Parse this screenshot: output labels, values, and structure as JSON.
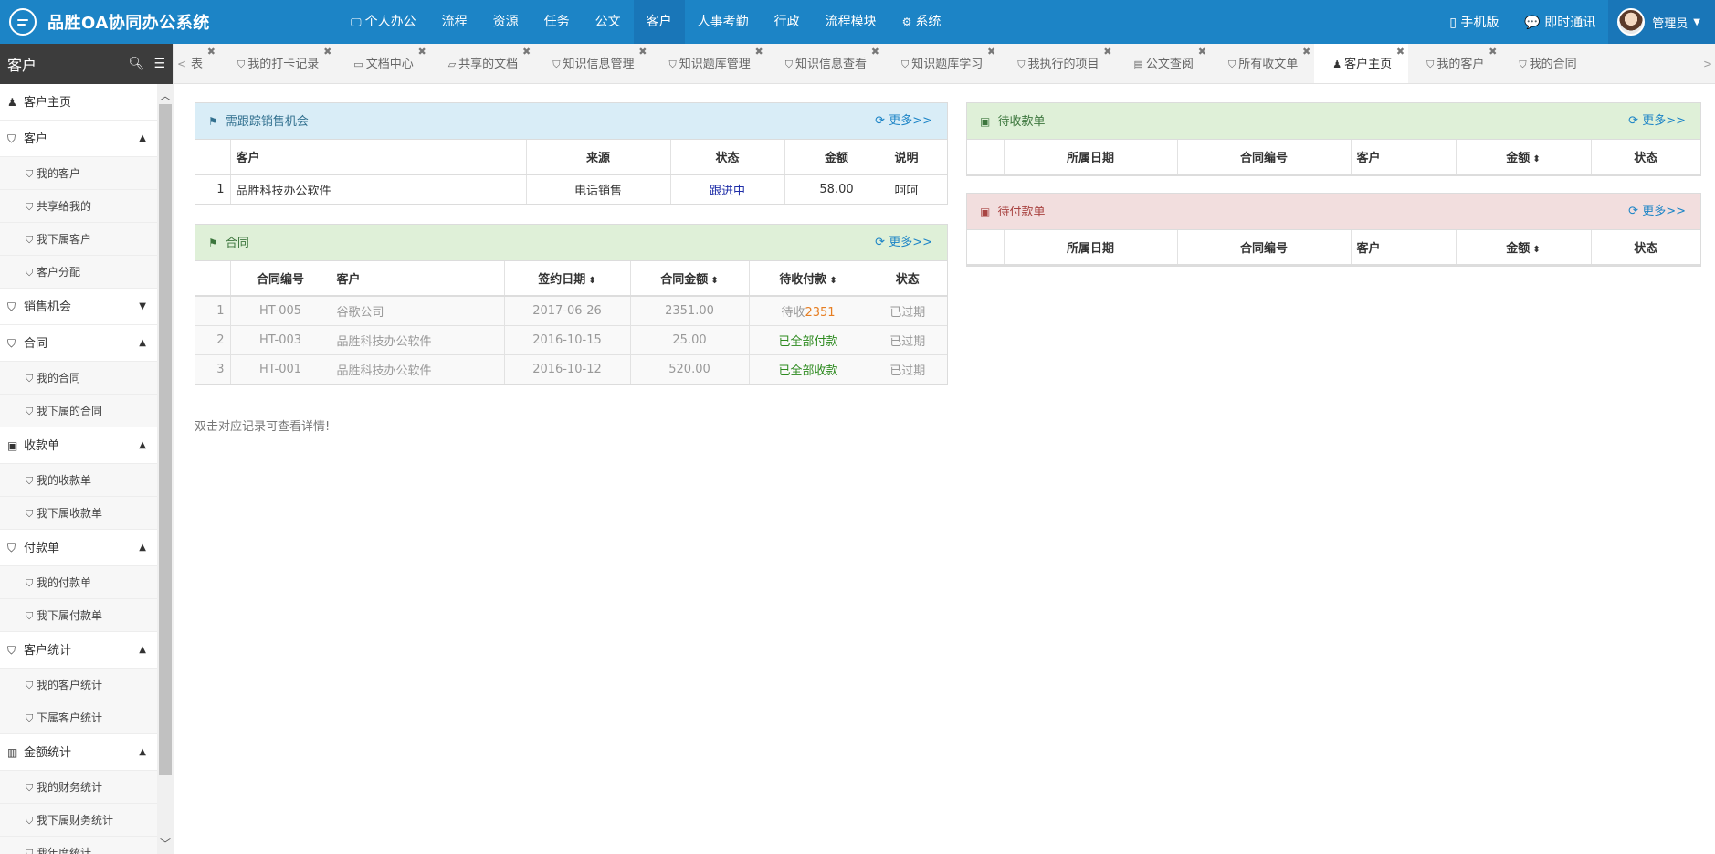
{
  "app": {
    "title": "品胜OA协同办公系统"
  },
  "topnav": [
    {
      "label": "个人办公",
      "icon": "monitor-icon",
      "glyph": "🖵"
    },
    {
      "label": "流程",
      "icon": "",
      "glyph": ""
    },
    {
      "label": "资源",
      "icon": "",
      "glyph": ""
    },
    {
      "label": "任务",
      "icon": "",
      "glyph": ""
    },
    {
      "label": "公文",
      "icon": "",
      "glyph": ""
    },
    {
      "label": "客户",
      "icon": "",
      "glyph": "",
      "active": true
    },
    {
      "label": "人事考勤",
      "icon": "",
      "glyph": ""
    },
    {
      "label": "行政",
      "icon": "",
      "glyph": ""
    },
    {
      "label": "流程模块",
      "icon": "",
      "glyph": ""
    },
    {
      "label": "系统",
      "icon": "gear-icon",
      "glyph": "⚙"
    }
  ],
  "topright": {
    "mobile": "手机版",
    "im": "即时通讯",
    "user": "管理员"
  },
  "sidebar": {
    "title": "客户",
    "items": [
      {
        "type": "group",
        "label": "客户主页",
        "icon": "person-icon",
        "glyph": "♟",
        "caret": ""
      },
      {
        "type": "group",
        "label": "客户",
        "icon": "bookmark-icon",
        "glyph": "⛉",
        "caret": "▲"
      },
      {
        "type": "sub",
        "label": "我的客户"
      },
      {
        "type": "sub",
        "label": "共享给我的"
      },
      {
        "type": "sub",
        "label": "我下属客户"
      },
      {
        "type": "sub",
        "label": "客户分配"
      },
      {
        "type": "group",
        "label": "销售机会",
        "icon": "bookmark-icon",
        "glyph": "⛉",
        "caret": "▼"
      },
      {
        "type": "group",
        "label": "合同",
        "icon": "bookmark-icon",
        "glyph": "⛉",
        "caret": "▲"
      },
      {
        "type": "sub",
        "label": "我的合同"
      },
      {
        "type": "sub",
        "label": "我下属的合同"
      },
      {
        "type": "group",
        "label": "收款单",
        "icon": "money-icon",
        "glyph": "▣",
        "caret": "▲"
      },
      {
        "type": "sub",
        "label": "我的收款单"
      },
      {
        "type": "sub",
        "label": "我下属收款单"
      },
      {
        "type": "group",
        "label": "付款单",
        "icon": "bookmark-icon",
        "glyph": "⛉",
        "caret": "▲"
      },
      {
        "type": "sub",
        "label": "我的付款单"
      },
      {
        "type": "sub",
        "label": "我下属付款单"
      },
      {
        "type": "group",
        "label": "客户统计",
        "icon": "bookmark-icon",
        "glyph": "⛉",
        "caret": "▲"
      },
      {
        "type": "sub",
        "label": "我的客户统计"
      },
      {
        "type": "sub",
        "label": "下属客户统计"
      },
      {
        "type": "group",
        "label": "金额统计",
        "icon": "bar-chart-icon",
        "glyph": "▥",
        "caret": "▲"
      },
      {
        "type": "sub",
        "label": "我的财务统计"
      },
      {
        "type": "sub",
        "label": "我下属财务统计"
      },
      {
        "type": "sub",
        "label": "我年度统计"
      }
    ]
  },
  "tabs": [
    {
      "label": "表",
      "icon": "",
      "glyph": "",
      "partial": true
    },
    {
      "label": "我的打卡记录",
      "icon": "bookmark-icon",
      "glyph": "⛉"
    },
    {
      "label": "文档中心",
      "icon": "folder-icon",
      "glyph": "▭"
    },
    {
      "label": "共享的文档",
      "icon": "folder-open-icon",
      "glyph": "▱"
    },
    {
      "label": "知识信息管理",
      "icon": "bookmark-icon",
      "glyph": "⛉"
    },
    {
      "label": "知识题库管理",
      "icon": "bookmark-icon",
      "glyph": "⛉"
    },
    {
      "label": "知识信息查看",
      "icon": "bookmark-icon",
      "glyph": "⛉"
    },
    {
      "label": "知识题库学习",
      "icon": "bookmark-icon",
      "glyph": "⛉"
    },
    {
      "label": "我执行的项目",
      "icon": "bookmark-icon",
      "glyph": "⛉"
    },
    {
      "label": "公文查阅",
      "icon": "briefcase-icon",
      "glyph": "▤"
    },
    {
      "label": "所有收文单",
      "icon": "bookmark-icon",
      "glyph": "⛉"
    },
    {
      "label": "客户主页",
      "icon": "person-icon",
      "glyph": "♟",
      "active": true
    },
    {
      "label": "我的客户",
      "icon": "bookmark-icon",
      "glyph": "⛉"
    },
    {
      "label": "我的合同",
      "icon": "bookmark-icon",
      "glyph": "⛉"
    }
  ],
  "panels": {
    "more_label": "更多>>",
    "sales": {
      "title": "需跟踪销售机会",
      "columns": [
        "",
        "客户",
        "来源",
        "状态",
        "金额",
        "说明"
      ],
      "rows": [
        {
          "no": "1",
          "customer": "品胜科技办公软件",
          "source": "电话销售",
          "status": "跟进中",
          "amount": "58.00",
          "note": "呵呵"
        }
      ]
    },
    "contract": {
      "title": "合同",
      "columns": [
        "",
        "合同编号",
        "客户",
        "签约日期",
        "合同金额",
        "待收付款",
        "状态"
      ],
      "rows": [
        {
          "no": "1",
          "code": "HT-005",
          "customer": "谷歌公司",
          "date": "2017-06-26",
          "amount": "2351.00",
          "pay_prefix": "待收",
          "pay_value": "2351",
          "pay_class": "orange",
          "status": "已过期"
        },
        {
          "no": "2",
          "code": "HT-003",
          "customer": "品胜科技办公软件",
          "date": "2016-10-15",
          "amount": "25.00",
          "pay_prefix": "",
          "pay_value": "已全部付款",
          "pay_class": "green",
          "status": "已过期"
        },
        {
          "no": "3",
          "code": "HT-001",
          "customer": "品胜科技办公软件",
          "date": "2016-10-12",
          "amount": "520.00",
          "pay_prefix": "",
          "pay_value": "已全部收款",
          "pay_class": "green",
          "status": "已过期"
        }
      ]
    },
    "receivable": {
      "title": "待收款单",
      "columns": [
        "",
        "所属日期",
        "合同编号",
        "客户",
        "金额",
        "状态"
      ]
    },
    "payable": {
      "title": "待付款单",
      "columns": [
        "",
        "所属日期",
        "合同编号",
        "客户",
        "金额",
        "状态"
      ]
    },
    "hint": "双击对应记录可查看详情!"
  }
}
